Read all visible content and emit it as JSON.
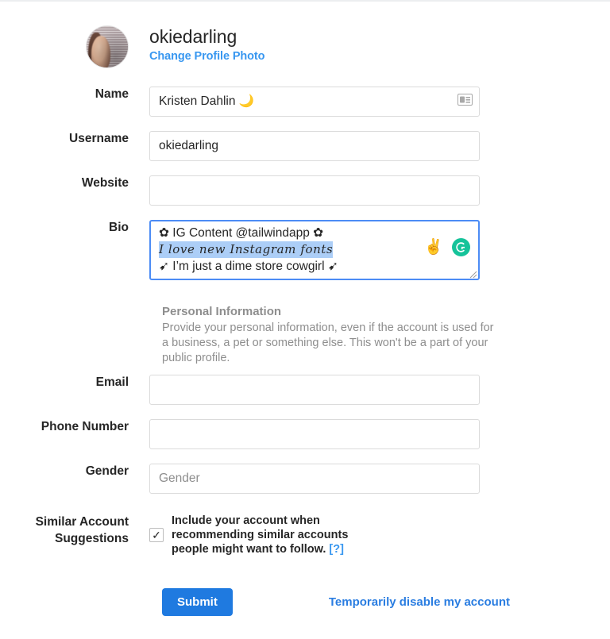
{
  "header": {
    "username": "okiedarling",
    "change_photo_label": "Change Profile Photo",
    "avatar_name": "profile-avatar"
  },
  "fields": {
    "name": {
      "label": "Name",
      "value": "Kristen Dahlin 🌙",
      "icon": "contact-card-icon"
    },
    "username": {
      "label": "Username",
      "value": "okiedarling"
    },
    "website": {
      "label": "Website",
      "value": "",
      "placeholder": ""
    },
    "bio": {
      "label": "Bio",
      "line1": "✿ IG Content @tailwindapp ✿",
      "line2": "I love new Instagram fonts",
      "line3": "➹ I’m just a dime store cowgirl ➹",
      "line2_selected": true,
      "tools": {
        "emoji_icon": "✌",
        "grammarly_label": "G"
      }
    },
    "email": {
      "label": "Email",
      "value": "",
      "placeholder": ""
    },
    "phone": {
      "label": "Phone Number",
      "value": "",
      "placeholder": ""
    },
    "gender": {
      "label": "Gender",
      "value": "",
      "placeholder": "Gender"
    }
  },
  "personal_information": {
    "title": "Personal Information",
    "description": "Provide your personal information, even if the account is used for a business, a pet or something else. This won't be a part of your public profile."
  },
  "similar_accounts": {
    "label_line1": "Similar Account",
    "label_line2": "Suggestions",
    "checked": true,
    "description": "Include your account when recommending similar accounts people might want to follow.",
    "help_label": "[?]"
  },
  "footer": {
    "submit_label": "Submit",
    "disable_label": "Temporarily disable my account"
  },
  "colors": {
    "link_blue": "#3897f0",
    "submit_blue": "#1f7ae0",
    "focus_border": "#4c8cf5",
    "selection_highlight": "#accef7",
    "grammarly_green": "#15c39a",
    "muted_text": "#8e8e8e",
    "input_border": "#dbdbdb"
  }
}
